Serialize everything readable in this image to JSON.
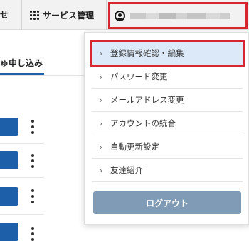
{
  "topbar": {
    "cut_left_text": "せ",
    "service_label": "サービス管理",
    "service_icon": "grid-icon",
    "account_icon": "user-icon"
  },
  "page": {
    "tab_label": "ゅ申し込み"
  },
  "menu": {
    "items": [
      {
        "label": "登録情報確認・編集",
        "active": true
      },
      {
        "label": "パスワード変更"
      },
      {
        "label": "メールアドレス変更"
      },
      {
        "label": "アカウントの統合"
      },
      {
        "label": "自動更新設定"
      },
      {
        "label": "友達紹介"
      }
    ],
    "logout_label": "ログアウト"
  },
  "colors": {
    "accent_blue": "#1d5fa8",
    "highlight_red": "#d7262f",
    "active_bg": "#dbe9f8",
    "logout_bg": "#7f9bb6"
  }
}
